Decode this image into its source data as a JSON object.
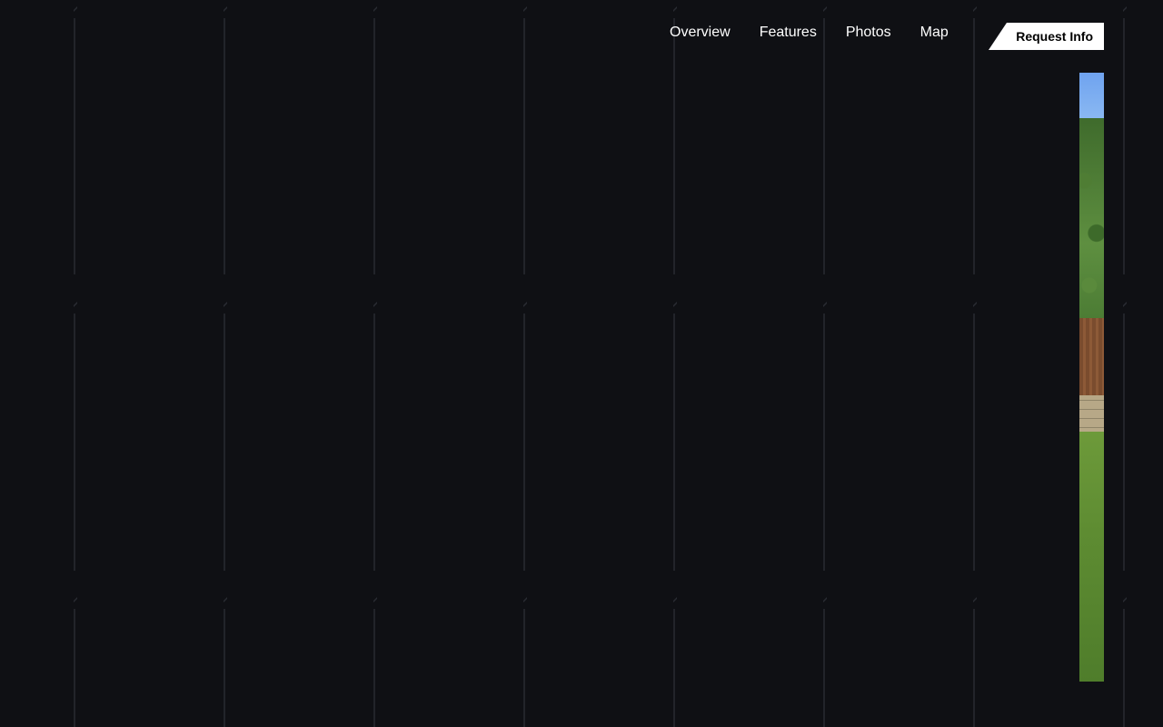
{
  "nav": {
    "items": [
      {
        "label": "Overview"
      },
      {
        "label": "Features"
      },
      {
        "label": "Photos"
      },
      {
        "label": "Map"
      }
    ],
    "cta_label": "Request Info"
  },
  "colors": {
    "background": "#0f1014",
    "grid_line": "#22242a",
    "nav_text": "#ffffff",
    "cta_bg": "#ffffff",
    "cta_text": "#000000"
  },
  "photo": {
    "icon": "yard-photo"
  }
}
